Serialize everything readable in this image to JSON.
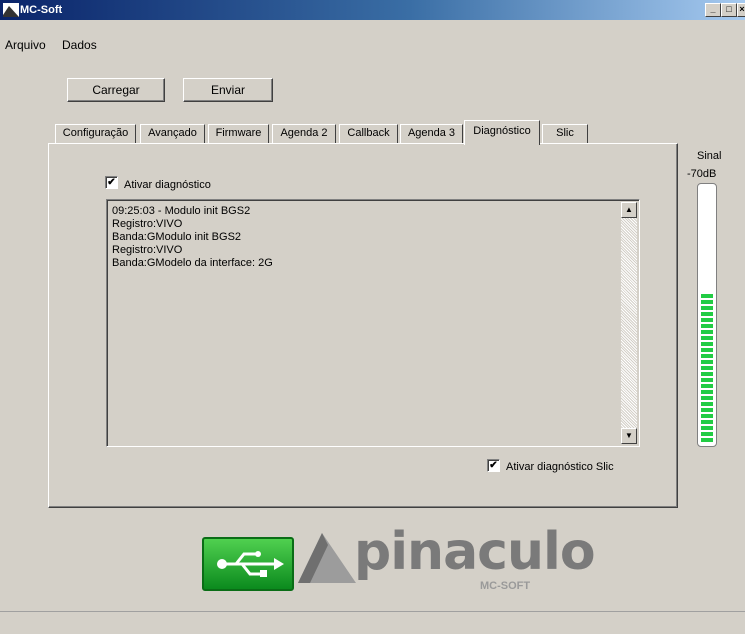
{
  "window": {
    "title": "MC-Soft"
  },
  "menu": {
    "items": [
      "Arquivo",
      "Dados"
    ]
  },
  "toolbar": {
    "load_label": "Carregar",
    "send_label": "Enviar"
  },
  "tabs": [
    {
      "label": "Configuração",
      "active": false
    },
    {
      "label": "Avançado",
      "active": false
    },
    {
      "label": "Firmware",
      "active": false
    },
    {
      "label": "Agenda 2",
      "active": false
    },
    {
      "label": "Callback",
      "active": false
    },
    {
      "label": "Agenda 3",
      "active": false
    },
    {
      "label": "Diagnóstico",
      "active": true
    },
    {
      "label": "Slic",
      "active": false
    }
  ],
  "diagnostics": {
    "enable_label": "Ativar diagnóstico",
    "enable_checked": true,
    "log_lines": [
      "09:25:03 - Modulo init BGS2",
      "Registro:VIVO",
      "Banda:GModulo init BGS2",
      "Registro:VIVO",
      "Banda:GModelo da interface: 2G"
    ],
    "slic_label": "Ativar diagnóstico Slic",
    "slic_checked": true
  },
  "signal": {
    "label": "Sinal",
    "value_text": "-70dB",
    "level_fraction": 0.62,
    "color": "#22cc44"
  },
  "branding": {
    "usb_icon": "usb-icon",
    "logo_text": "pinaculo",
    "logo_sub": "MC-SOFT"
  }
}
